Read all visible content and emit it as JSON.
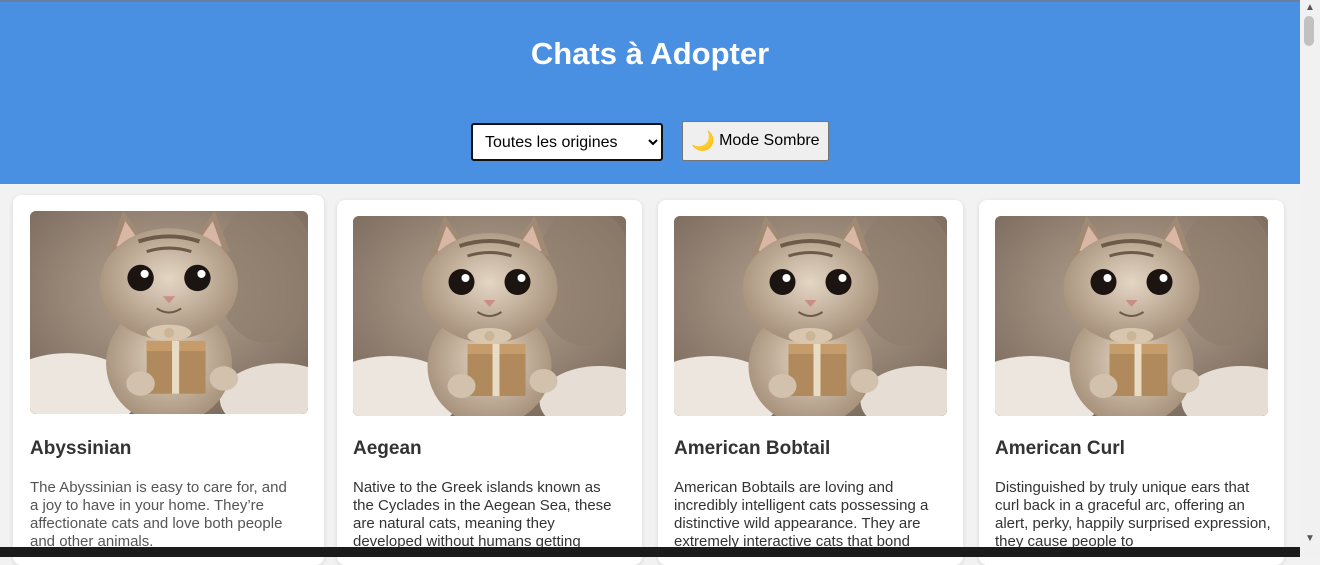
{
  "header": {
    "title": "Chats à Adopter",
    "origin_filter": {
      "selected": "Toutes les origines"
    },
    "dark_mode_button": {
      "icon": "moon-icon",
      "label": "Mode Sombre"
    }
  },
  "colors": {
    "header_bg": "#4a90e2",
    "page_bg": "#f2f2f2",
    "card_bg": "#ffffff",
    "moon": "#f0a000"
  },
  "cats": [
    {
      "name": "Abyssinian",
      "description": "The Abyssinian is easy to care for, and a joy to have in your home. They’re affectionate cats and love both people and other animals."
    },
    {
      "name": "Aegean",
      "description": "Native to the Greek islands known as the Cyclades in the Aegean Sea, these are natural cats, meaning they developed without humans getting"
    },
    {
      "name": "American Bobtail",
      "description": "American Bobtails are loving and incredibly intelligent cats possessing a distinctive wild appearance. They are extremely interactive cats that bond"
    },
    {
      "name": "American Curl",
      "description": "Distinguished by truly unique ears that curl back in a graceful arc, offering an alert, perky, happily surprised expression, they cause people to"
    }
  ]
}
